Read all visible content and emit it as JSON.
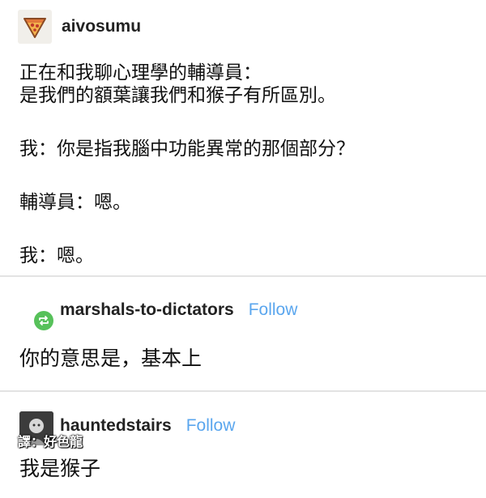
{
  "post": {
    "username": "aivosumu",
    "paragraphs": [
      "正在和我聊心理學的輔導員：",
      "是我們的額葉讓我們和猴子有所區別。",
      "我：你是指我腦中功能異常的那個部分？",
      "輔導員：嗯。",
      "我：嗯。"
    ]
  },
  "reblogs": [
    {
      "username": "marshals-to-dictators",
      "follow_label": "Follow",
      "text": "你的意思是，基本上"
    },
    {
      "username": "hauntedstairs",
      "follow_label": "Follow",
      "text": "我是猴子"
    }
  ],
  "watermark": "譯：好色龍",
  "colors": {
    "follow": "#5aa6ee",
    "reblog_badge": "#57c15a",
    "divider": "#e3e3e3"
  },
  "icons": {
    "avatar": "pizza-slice-icon",
    "reblog": "reblog-icon"
  }
}
